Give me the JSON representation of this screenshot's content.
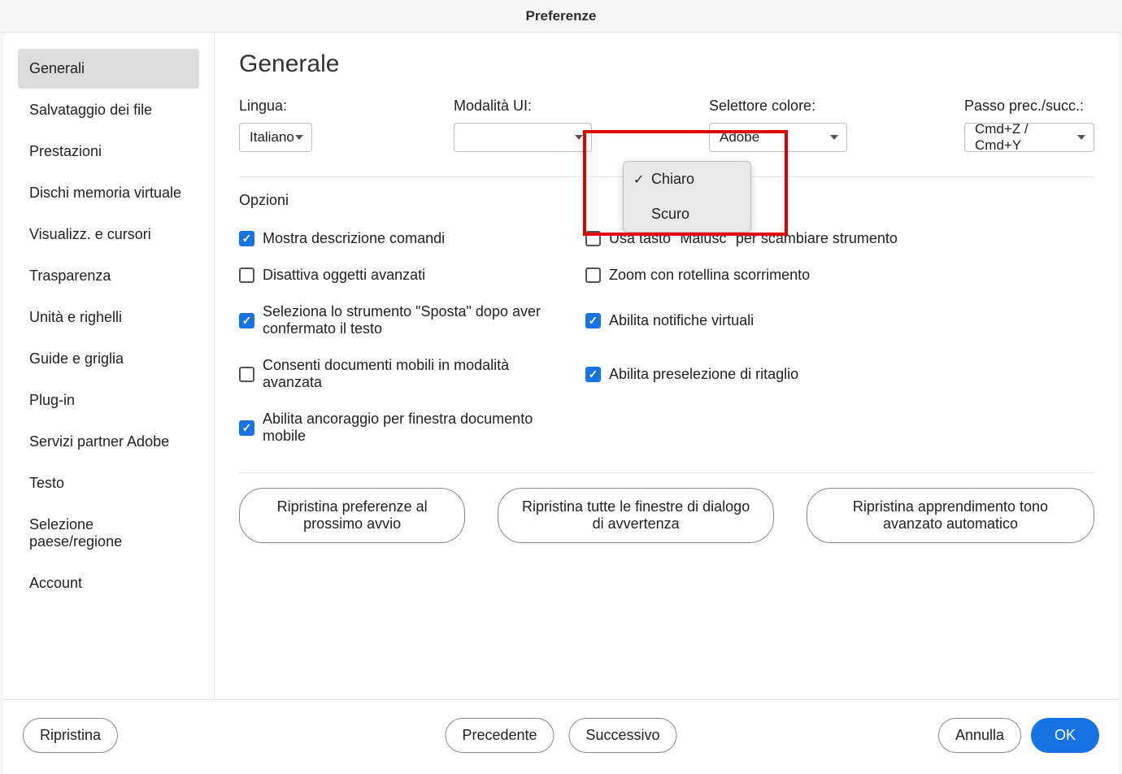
{
  "title": "Preferenze",
  "sidebar": {
    "items": [
      {
        "label": "Generali",
        "active": true
      },
      {
        "label": "Salvataggio dei file",
        "active": false
      },
      {
        "label": "Prestazioni",
        "active": false
      },
      {
        "label": "Dischi memoria virtuale",
        "active": false
      },
      {
        "label": "Visualizz. e cursori",
        "active": false
      },
      {
        "label": "Trasparenza",
        "active": false
      },
      {
        "label": "Unità e righelli",
        "active": false
      },
      {
        "label": "Guide e griglia",
        "active": false
      },
      {
        "label": "Plug-in",
        "active": false
      },
      {
        "label": "Servizi partner Adobe",
        "active": false
      },
      {
        "label": "Testo",
        "active": false
      },
      {
        "label": "Selezione paese/regione",
        "active": false
      },
      {
        "label": "Account",
        "active": false
      }
    ]
  },
  "main": {
    "heading": "Generale",
    "fields": {
      "language": {
        "label": "Lingua:",
        "value": "Italiano"
      },
      "uiMode": {
        "label": "Modalità UI:",
        "value": "",
        "options": [
          {
            "label": "Chiaro",
            "checked": true
          },
          {
            "label": "Scuro",
            "checked": false
          }
        ]
      },
      "colorPicker": {
        "label": "Selettore colore:",
        "value": "Adobe"
      },
      "undoStep": {
        "label": "Passo prec./succ.:",
        "value": "Cmd+Z / Cmd+Y"
      }
    },
    "optionsLabel": "Opzioni",
    "options": {
      "leftColumn": [
        {
          "label": "Mostra descrizione comandi",
          "checked": true
        },
        {
          "label": "Disattiva oggetti avanzati",
          "checked": false
        },
        {
          "label": "Seleziona lo strumento \"Sposta\" dopo aver confermato il testo",
          "checked": true
        },
        {
          "label": "Consenti documenti mobili in modalità avanzata",
          "checked": false
        },
        {
          "label": "Abilita ancoraggio per finestra documento mobile",
          "checked": true
        }
      ],
      "rightColumn": [
        {
          "label": "Usa tasto \"Maiusc\" per scambiare strumento",
          "checked": false
        },
        {
          "label": "Zoom con rotellina scorrimento",
          "checked": false
        },
        {
          "label": "Abilita notifiche virtuali",
          "checked": true
        },
        {
          "label": "Abilita preselezione di ritaglio",
          "checked": true
        }
      ]
    },
    "actions": [
      "Ripristina preferenze al prossimo avvio",
      "Ripristina tutte le finestre di dialogo di avvertenza",
      "Ripristina apprendimento tono avanzato automatico"
    ]
  },
  "footer": {
    "reset": "Ripristina",
    "previous": "Precedente",
    "next": "Successivo",
    "cancel": "Annulla",
    "ok": "OK"
  }
}
